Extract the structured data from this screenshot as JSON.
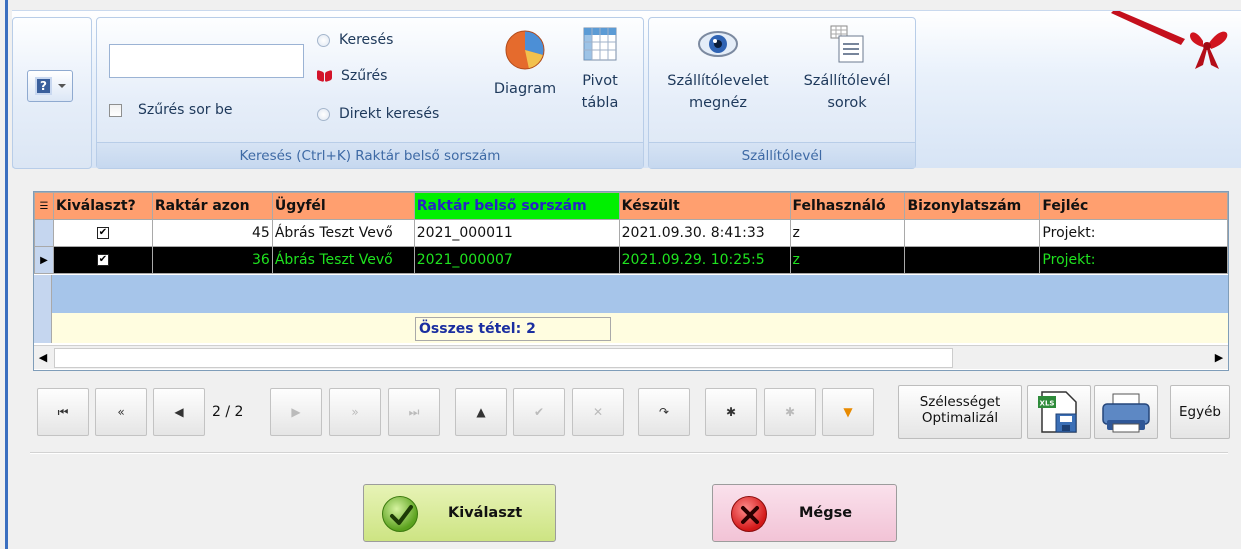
{
  "ribbon": {
    "search_group": {
      "filter_row_label": "Szűrés sor be",
      "radio_search": "Keresés",
      "radio_filter": "Szűrés",
      "radio_direct": "Direkt keresés",
      "diagram_label": "Diagram",
      "pivot_label_1": "Pivot",
      "pivot_label_2": "tábla",
      "caption": "Keresés (Ctrl+K) Raktár belső sorszám"
    },
    "delivery_group": {
      "view_label_1": "Szállítólevelet",
      "view_label_2": "megnéz",
      "rows_label_1": "Szállítólevél",
      "rows_label_2": "sorok",
      "caption": "Szállítólevél"
    }
  },
  "grid": {
    "columns": [
      "Kiválaszt?",
      "Raktár azon",
      "Ügyfél",
      "Raktár belső sorszám",
      "Készült",
      "Felhasználó",
      "Bizonylatszám",
      "Fejléc"
    ],
    "rows": [
      {
        "checked": "✔",
        "raktar_azon": "45",
        "ugyfel": "Ábrás Teszt Vevő",
        "belso_sorszam": "2021_000011",
        "keszult": "2021.09.30. 8:41:33",
        "felhasznalo": "z",
        "bizonylatszam": "",
        "fejlec": "Projekt:"
      },
      {
        "checked": "✔",
        "raktar_azon": "36",
        "ugyfel": "Ábrás Teszt Vevő",
        "belso_sorszam": "2021_000007",
        "keszult": "2021.09.29. 10:25:5",
        "felhasznalo": "z",
        "bizonylatszam": "",
        "fejlec": "Projekt:"
      }
    ],
    "summary": "Összes tétel: 2"
  },
  "navigator": {
    "first": "⏮",
    "prev_page": "«",
    "prev": "◀",
    "page": "2 / 2",
    "next": "▶",
    "next_page": "»",
    "last": "⏭",
    "up": "▲",
    "post": "✔",
    "cancel": "✕",
    "refresh": "↷",
    "insert": "✱",
    "delete": "✱",
    "filter": "▼",
    "optimize_1": "Szélességet",
    "optimize_2": "Optimalizál",
    "other": "Egyéb",
    "xls_badge": "XLS"
  },
  "actions": {
    "select": "Kiválaszt",
    "cancel": "Mégse"
  },
  "colors": {
    "header_bg": "#ff9f6f",
    "sorted_header_bg": "#00f000",
    "selected_row_text": "#1fe21f",
    "select_button_bg": "#d9ec9f",
    "cancel_button_bg": "#f4cde0"
  }
}
